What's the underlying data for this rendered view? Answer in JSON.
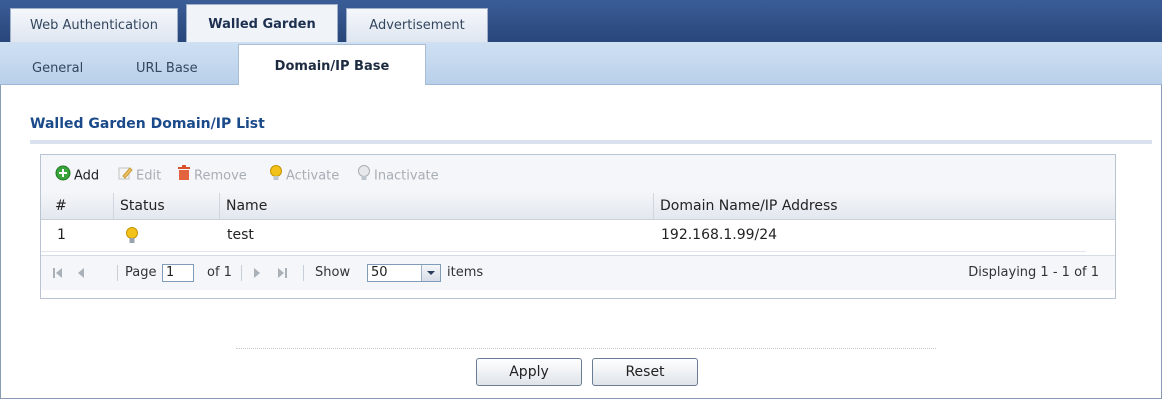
{
  "tabs_primary": [
    {
      "label": "Web Authentication",
      "active": false
    },
    {
      "label": "Walled Garden",
      "active": true
    },
    {
      "label": "Advertisement",
      "active": false
    }
  ],
  "tabs_secondary": [
    {
      "label": "General",
      "active": false
    },
    {
      "label": "URL Base",
      "active": false
    },
    {
      "label": "Domain/IP Base",
      "active": true
    }
  ],
  "section": {
    "title": "Walled Garden Domain/IP List"
  },
  "toolbar": {
    "add": "Add",
    "edit": "Edit",
    "remove": "Remove",
    "activate": "Activate",
    "inactivate": "Inactivate"
  },
  "table": {
    "columns": [
      "#",
      "Status",
      "Name",
      "Domain Name/IP Address"
    ],
    "rows": [
      {
        "index": "1",
        "status_icon": "bulb-on-icon",
        "name": "test",
        "address": "192.168.1.99/24"
      }
    ]
  },
  "pager": {
    "page_label": "Page",
    "page_value": "1",
    "of_label": "of 1",
    "show_label": "Show",
    "show_value": "50",
    "items_label": "items",
    "displaying": "Displaying 1 - 1 of 1"
  },
  "buttons": {
    "apply": "Apply",
    "reset": "Reset"
  },
  "colors": {
    "header_blue": "#2f4f86",
    "title_blue": "#1b4a8a",
    "bulb_yellow": "#f3c21a",
    "add_green": "#3aa53a",
    "remove_red": "#d9502f"
  }
}
